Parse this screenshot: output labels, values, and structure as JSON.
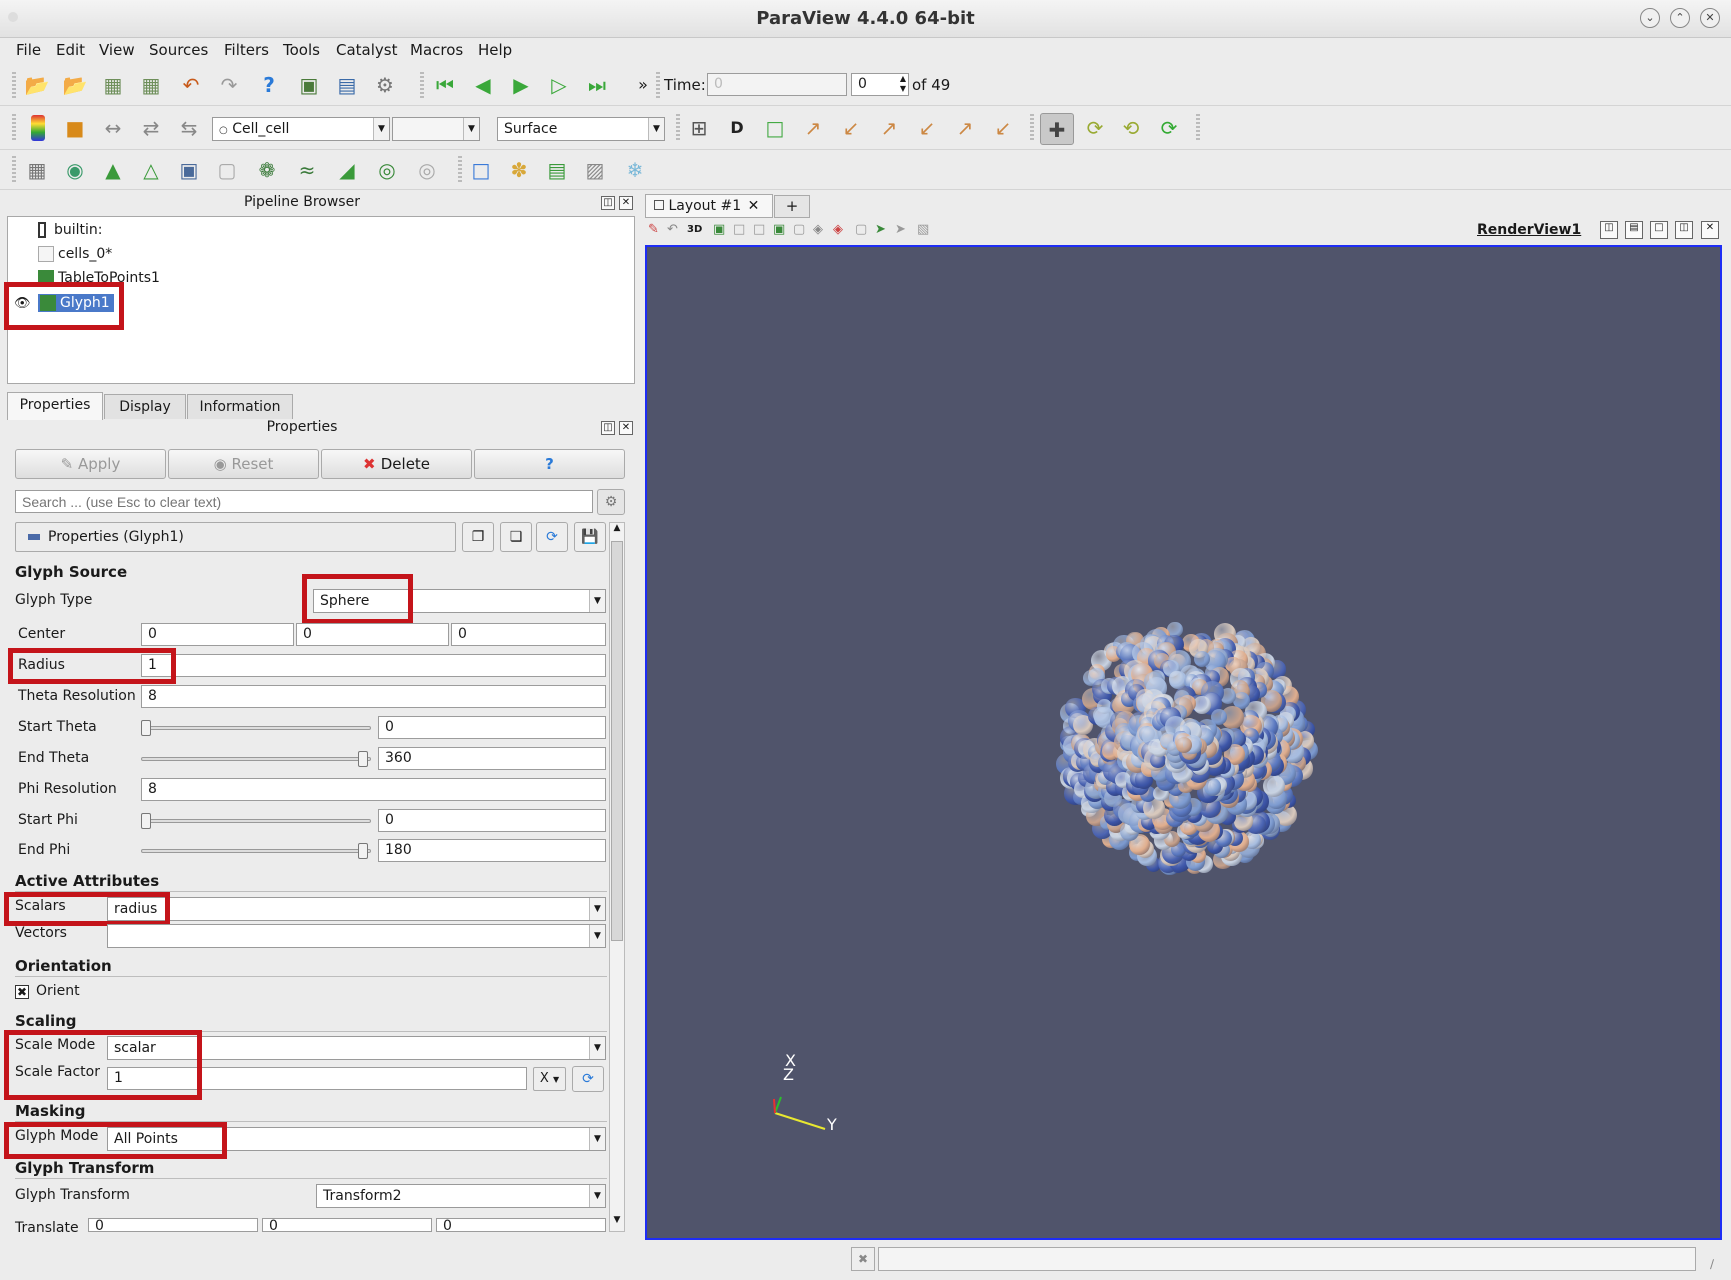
{
  "window": {
    "title": "ParaView 4.4.0 64-bit"
  },
  "menubar": [
    "File",
    "Edit",
    "View",
    "Sources",
    "Filters",
    "Tools",
    "Catalyst",
    "Macros",
    "Help"
  ],
  "time_toolbar": {
    "time_label": "Time:",
    "time_value": "0",
    "step_value": "0",
    "of_label": "of 49"
  },
  "display_toolbar": {
    "array_combo": "Cell_cell",
    "component_combo": "",
    "representation": "Surface"
  },
  "pipeline_browser": {
    "title": "Pipeline Browser",
    "items": [
      {
        "label": "builtin:"
      },
      {
        "label": "cells_0*"
      },
      {
        "label": "TableToPoints1"
      },
      {
        "label": "Glyph1"
      }
    ]
  },
  "tabs": [
    "Properties",
    "Display",
    "Information"
  ],
  "properties_panel": {
    "title": "Properties",
    "apply": "Apply",
    "reset": "Reset",
    "delete": "Delete",
    "help": "?",
    "search_placeholder": "Search ... (use Esc to clear text)",
    "section_header": "Properties (Glyph1)",
    "glyph_source": {
      "heading": "Glyph Source",
      "glyph_type_label": "Glyph Type",
      "glyph_type": "Sphere",
      "center_label": "Center",
      "center": [
        "0",
        "0",
        "0"
      ],
      "radius_label": "Radius",
      "radius": "1",
      "theta_res_label": "Theta Resolution",
      "theta_res": "8",
      "start_theta_label": "Start Theta",
      "start_theta": "0",
      "end_theta_label": "End Theta",
      "end_theta": "360",
      "phi_res_label": "Phi Resolution",
      "phi_res": "8",
      "start_phi_label": "Start Phi",
      "start_phi": "0",
      "end_phi_label": "End Phi",
      "end_phi": "180"
    },
    "active_attributes": {
      "heading": "Active Attributes",
      "scalars_label": "Scalars",
      "scalars": "radius",
      "vectors_label": "Vectors",
      "vectors": ""
    },
    "orientation": {
      "heading": "Orientation",
      "orient_label": "Orient",
      "orient_checked": true
    },
    "scaling": {
      "heading": "Scaling",
      "scale_mode_label": "Scale Mode",
      "scale_mode": "scalar",
      "scale_factor_label": "Scale Factor",
      "scale_factor": "1",
      "axis_btn": "X"
    },
    "masking": {
      "heading": "Masking",
      "glyph_mode_label": "Glyph Mode",
      "glyph_mode": "All Points"
    },
    "glyph_transform": {
      "heading": "Glyph Transform",
      "label": "Glyph Transform",
      "value": "Transform2",
      "translate_label": "Translate",
      "translate": [
        "0",
        "0",
        "0"
      ]
    }
  },
  "layout": {
    "tab_label": "Layout #1",
    "add_tab": "+",
    "view_name": "RenderView1",
    "mode_3d": "3D"
  },
  "axes": {
    "x": "X",
    "y": "Y",
    "z": "Z"
  },
  "colors": {
    "highlight_red": "#c4141a",
    "render_bg": "#50546b",
    "selection_blue": "#4a79c9"
  }
}
